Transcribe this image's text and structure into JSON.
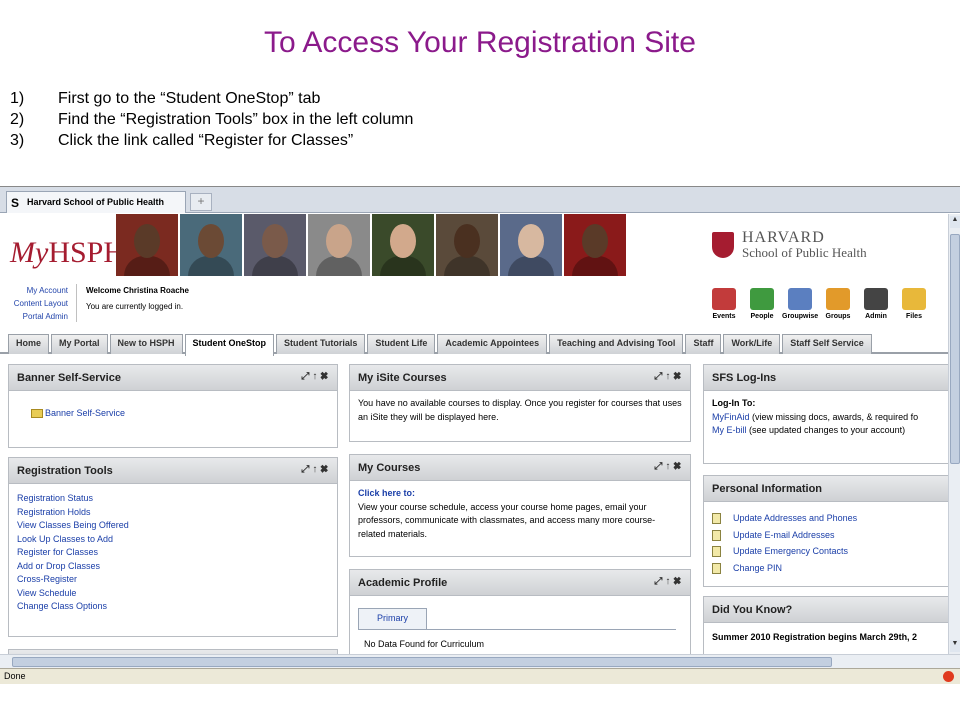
{
  "slide": {
    "title": "To Access Your Registration Site",
    "steps": [
      {
        "num": "1)",
        "text": "First go to the “Student OneStop” tab"
      },
      {
        "num": "2)",
        "text": "Find the “Registration Tools” box in the left column"
      },
      {
        "num": "3)",
        "text": "Click the link called “Register for Classes”"
      }
    ]
  },
  "browser": {
    "tab_title": "Harvard School of Public Health",
    "favicon": "S",
    "new_tab": "+",
    "status": "Done"
  },
  "banner": {
    "logo_prefix": "My",
    "logo_suffix": "HSPH",
    "harvard_line1": "HARVARD",
    "harvard_line2": "School of Public Health",
    "photo_colors": [
      [
        "#5a3a28",
        "#7b2a20"
      ],
      [
        "#6b4a35",
        "#4a6a7a"
      ],
      [
        "#7a5a4a",
        "#5a5a6a"
      ],
      [
        "#c9a48a",
        "#8a8a8a"
      ],
      [
        "#d2a98c",
        "#3a4a2a"
      ],
      [
        "#4a3020",
        "#5a4a3a"
      ],
      [
        "#d7b8a0",
        "#5a6a8a"
      ],
      [
        "#5a3a28",
        "#8a1a1a"
      ]
    ]
  },
  "user": {
    "links": [
      "My Account",
      "Content Layout",
      "Portal Admin"
    ],
    "welcome": "Welcome Christina Roache",
    "logged_in": "You are currently logged in.",
    "tools": [
      {
        "label": "Events",
        "icon": "calendar-icon",
        "color": "#c23b3b"
      },
      {
        "label": "People",
        "icon": "people-icon",
        "color": "#3f9a3f"
      },
      {
        "label": "Groupwise",
        "icon": "at-icon",
        "color": "#5b7fc0"
      },
      {
        "label": "Groups",
        "icon": "groups-icon",
        "color": "#e29a2a"
      },
      {
        "label": "Admin",
        "icon": "gear-icon",
        "color": "#444444"
      },
      {
        "label": "Files",
        "icon": "folder-icon",
        "color": "#e8b83a"
      }
    ]
  },
  "nav_tabs": [
    "Home",
    "My Portal",
    "New to HSPH",
    "Student OneStop",
    "Student Tutorials",
    "Student Life",
    "Academic Appointees",
    "Teaching and Advising Tool",
    "Staff",
    "Work/Life",
    "Staff Self Service"
  ],
  "active_tab": "Student OneStop",
  "portlet_controls": "⤢↑✖",
  "left": {
    "banner_ss": {
      "title": "Banner Self-Service",
      "item": "Banner Self-Service"
    },
    "reg_tools": {
      "title": "Registration Tools",
      "links": [
        "Registration Status",
        "Registration Holds",
        "View Classes Being Offered",
        "Look Up Classes to Add",
        "Register for Classes",
        "Add or Drop Classes",
        "Cross-Register",
        "View Schedule",
        "Change Class Options"
      ]
    }
  },
  "middle": {
    "isite": {
      "title": "My iSite Courses",
      "text": "You have no available courses to display. Once you register for courses that uses an iSite they will be displayed here."
    },
    "courses": {
      "title": "My Courses",
      "link": "Click here to:",
      "text": "View your course schedule, access your course home pages, email your professors, communicate with classmates, and access many more course-related materials."
    },
    "profile": {
      "title": "Academic Profile",
      "tab": "Primary",
      "text": "No Data Found for Curriculum"
    }
  },
  "right": {
    "sfs": {
      "title": "SFS Log-Ins",
      "subtitle": "Log-In To:",
      "l1_link": "MyFinAid",
      "l1_text": " (view missing docs, awards, & required fo",
      "l2_link": "My E-bill",
      "l2_text": "  (see updated changes to your account)"
    },
    "personal": {
      "title": "Personal Information",
      "links": [
        "Update Addresses and Phones",
        "Update E-mail Addresses",
        "Update Emergency Contacts",
        "Change PIN"
      ]
    },
    "dyk": {
      "title": "Did You Know?",
      "text": "Summer 2010 Registration begins March 29th, 2"
    }
  }
}
